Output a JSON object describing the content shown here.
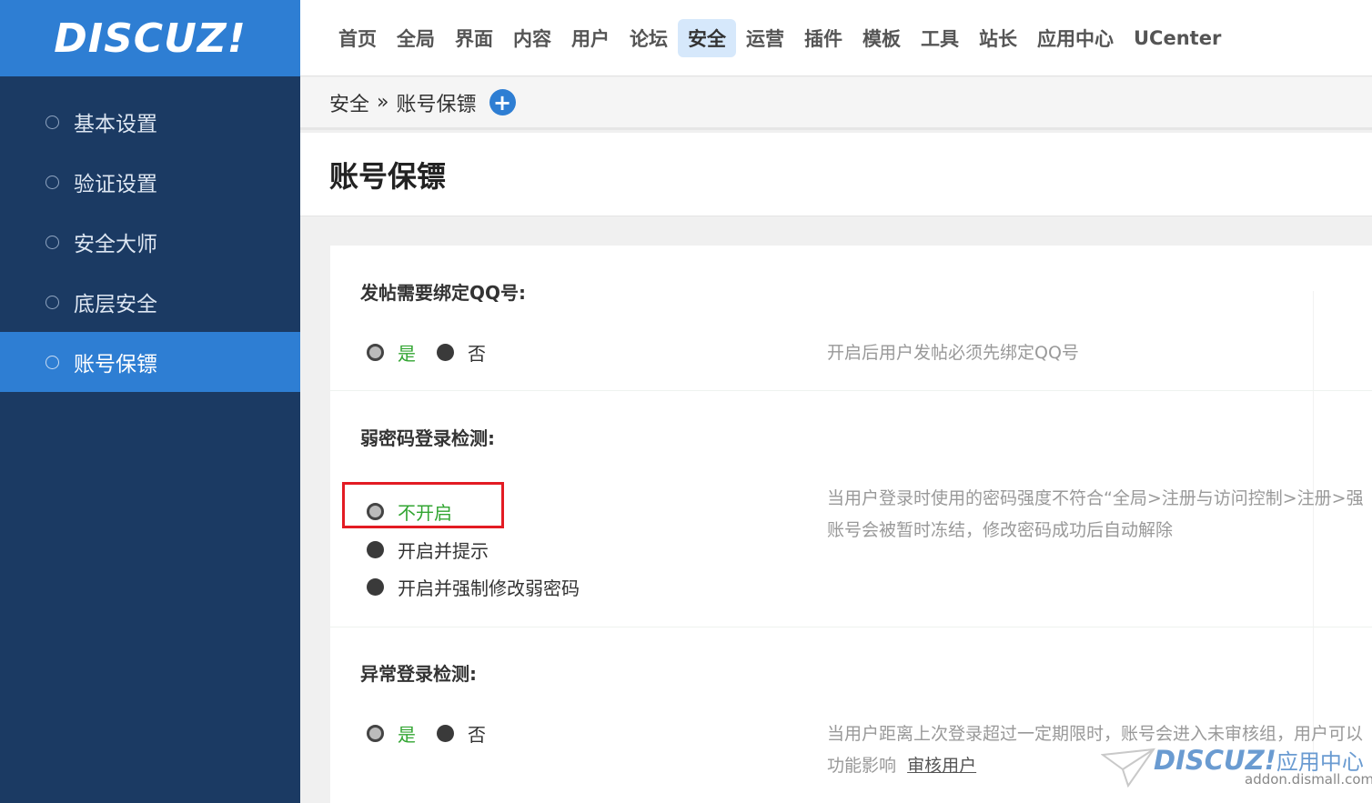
{
  "app": {
    "logo": "DISCUZ!"
  },
  "sidebar": {
    "items": [
      {
        "label": "基本设置"
      },
      {
        "label": "验证设置"
      },
      {
        "label": "安全大师"
      },
      {
        "label": "底层安全"
      },
      {
        "label": "账号保镖",
        "active": true
      }
    ]
  },
  "topnav": {
    "items": [
      {
        "label": "首页"
      },
      {
        "label": "全局"
      },
      {
        "label": "界面"
      },
      {
        "label": "内容"
      },
      {
        "label": "用户"
      },
      {
        "label": "论坛"
      },
      {
        "label": "安全",
        "active": true
      },
      {
        "label": "运营"
      },
      {
        "label": "插件"
      },
      {
        "label": "模板"
      },
      {
        "label": "工具"
      },
      {
        "label": "站长"
      },
      {
        "label": "应用中心"
      },
      {
        "label": "UCenter"
      }
    ]
  },
  "breadcrumb": {
    "parent": "安全",
    "separator": "»",
    "current": "账号保镖",
    "add_icon": "+"
  },
  "page": {
    "title": "账号保镖"
  },
  "settings": {
    "qq_binding": {
      "label": "发帖需要绑定QQ号:",
      "options": [
        "是",
        "否"
      ],
      "selected": "是",
      "desc": "开启后用户发帖必须先绑定QQ号"
    },
    "weak_password": {
      "label": "弱密码登录检测:",
      "options": [
        "不开启",
        "开启并提示",
        "开启并强制修改弱密码"
      ],
      "selected": "不开启",
      "desc_line1": "当用户登录时使用的密码强度不符合“全局>注册与访问控制>注册>强",
      "desc_line2": "账号会被暂时冻结，修改密码成功后自动解除"
    },
    "abnormal_login": {
      "label": "异常登录检测:",
      "options": [
        "是",
        "否"
      ],
      "selected": "是",
      "desc_line1": "当用户距离上次登录超过一定期限时，账号会进入未审核组，用户可以",
      "desc_line2": "功能影响",
      "desc_link": "审核用户"
    }
  },
  "watermark": {
    "brand": "DISCUZ!",
    "cn": "应用中心",
    "url": "addon.dismall.com"
  },
  "colors": {
    "sidebar": "#1b3a63",
    "accent": "#2e7ed3",
    "checked": "#32a532",
    "highlight": "#e31b23"
  }
}
